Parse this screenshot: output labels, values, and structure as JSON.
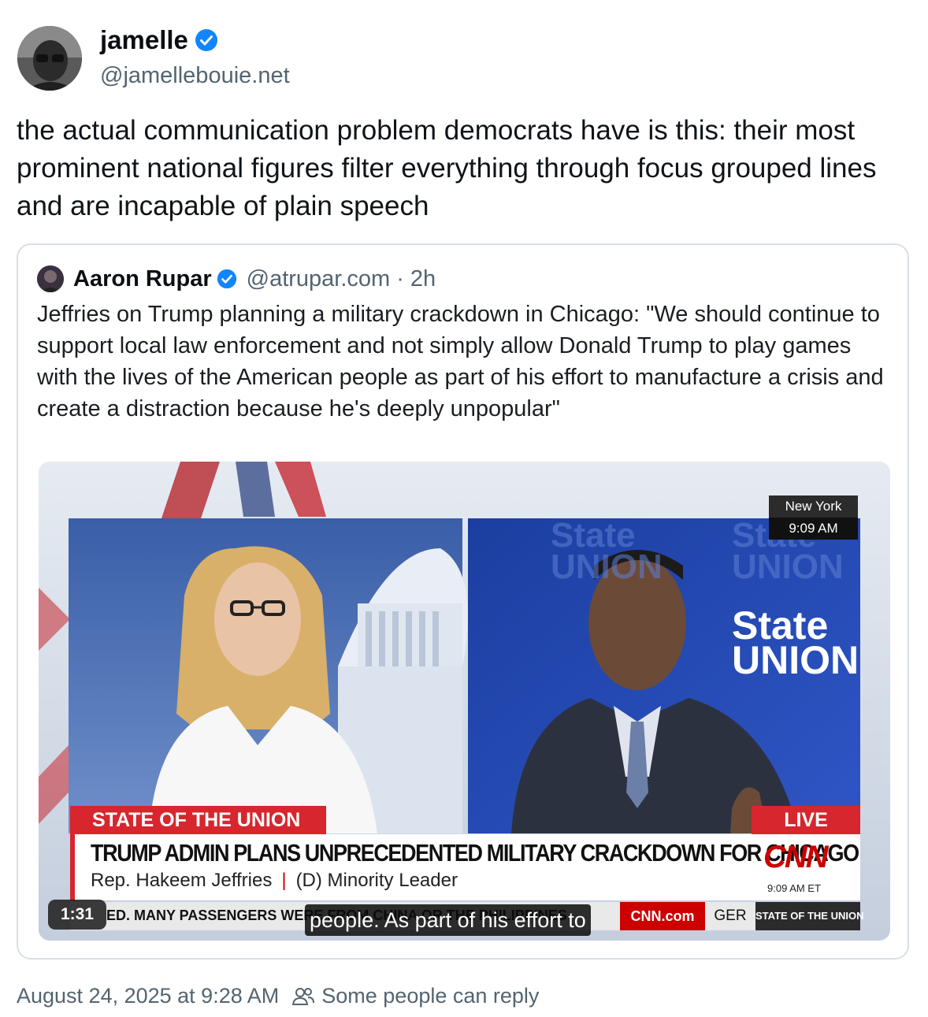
{
  "author": {
    "display_name": "jamelle",
    "handle": "@jamellebouie.net"
  },
  "post": {
    "text": "the actual communication problem democrats have is this: their most prominent national figures filter everything through focus grouped lines and are incapable of plain speech"
  },
  "quote": {
    "display_name": "Aaron Rupar",
    "handle": "@atrupar.com",
    "separator": "·",
    "age": "2h",
    "text": "Jeffries on Trump planning a military crackdown in Chicago: \"We should continue to support local law enforcement and not simply allow Donald Trump to play games with the lives of the American people as part of his effort to manufacture a crisis and create a distraction because he's deeply unpopular\""
  },
  "video": {
    "location": "New York",
    "location_time": "9:09 AM",
    "show_banner": "STATE OF THE UNION",
    "live_label": "LIVE",
    "headline": "TRUMP ADMIN PLANS UNPRECEDENTED MILITARY CRACKDOWN FOR CHICAGO",
    "guest_name": "Rep. Hakeem Jeffries",
    "guest_divider": "|",
    "guest_title": "(D) Minority Leader",
    "network_logo": "CNN",
    "network_time": "9:09 AM ET",
    "ticker": "ED. MANY PASSENGERS WERE FROM CHINA OR THE PHILIPPINES",
    "ticker_site": "CNN.com",
    "ticker_next": "GER",
    "ticker_show": "STATE OF THE UNION",
    "bg_text": "State of the UNION",
    "bg_logo_state": "State",
    "bg_logo_union": "UNION",
    "duration": "1:31",
    "caption": "people. As part of his effort to"
  },
  "footer": {
    "timestamp": "August 24, 2025 at 9:28 AM",
    "reply_setting": "Some people can reply",
    "reply_icon": "people-icon"
  },
  "colors": {
    "verified_blue": "#1185fe",
    "cnn_red": "#cc0000",
    "muted_text": "#536471"
  }
}
